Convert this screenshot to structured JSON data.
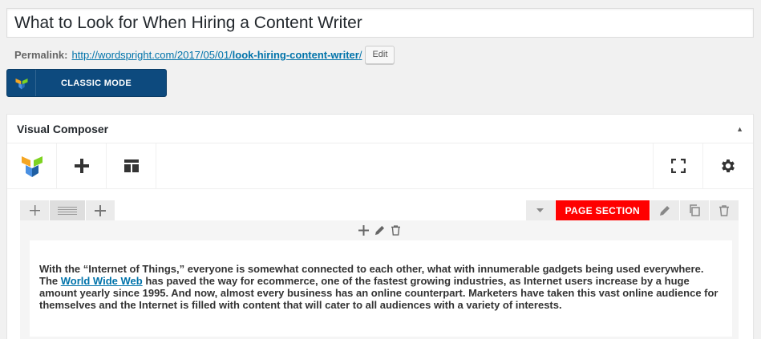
{
  "post": {
    "title": "What to Look for When Hiring a Content Writer"
  },
  "permalink": {
    "label": "Permalink:",
    "url_base": "http://wordspright.com/2017/05/01/",
    "url_slug": "look-hiring-content-writer",
    "url_tail": "/",
    "edit_label": "Edit"
  },
  "mode_button": {
    "label": "CLASSIC MODE"
  },
  "composer": {
    "title": "Visual Composer",
    "toggle_arrow": "▲",
    "section_label": "PAGE SECTION"
  },
  "content": {
    "part1": "With the “Internet of Things,” everyone is somewhat connected to each other, what with innumerable gadgets being used everywhere. The ",
    "link_text": "World Wide Web",
    "part2": " has paved the way for ecommerce, one of the fastest growing industries, as Internet users increase by a huge amount yearly since 1995. And now, almost every business has an online counterpart. Marketers have taken this vast online audience for themselves and the Internet is filled with content that will cater to all audiences with a variety of interests."
  },
  "colors": {
    "accent_blue": "#0d4a7e",
    "link": "#0073aa",
    "section_red": "#ff0000"
  },
  "icons": [
    "vc-logo-icon",
    "plus-icon",
    "layout-icon",
    "fullscreen-icon",
    "gear-icon",
    "move-icon",
    "row-layout-icon",
    "chevron-down-icon",
    "pencil-icon",
    "clone-icon",
    "trash-icon"
  ]
}
